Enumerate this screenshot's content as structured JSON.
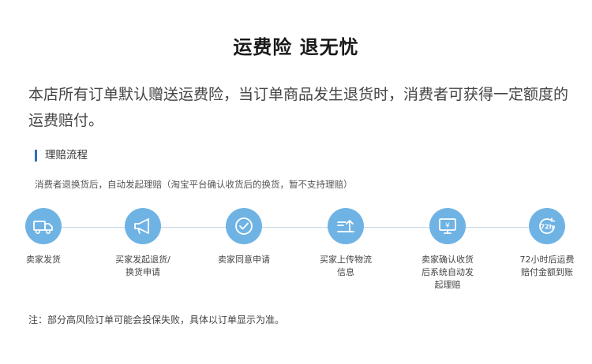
{
  "title": "运费险  退无忧",
  "intro": "本店所有订单默认赠送运费险，当订单商品发生退货时，消费者可获得一定额度的运费赔付。",
  "section": {
    "title": "理赔流程",
    "description": "消费者退换货后，自动发起理赔（淘宝平台确认收货后的换货，暂不支持理赔）"
  },
  "steps": [
    {
      "label": "卖家发货",
      "icon": "truck-icon"
    },
    {
      "label": "买家发起退货/\n换货申请",
      "icon": "megaphone-icon"
    },
    {
      "label": "卖家同意申请",
      "icon": "check-circle-icon"
    },
    {
      "label": "买家上传物流\n信息",
      "icon": "upload-icon"
    },
    {
      "label": "卖家确认收货\n后系统自动发\n起理赔",
      "icon": "monitor-yen-icon"
    },
    {
      "label": "72小时后运费\n赔付金额到账",
      "icon": "clock-72h-icon"
    }
  ],
  "clock_text": "72h",
  "yen_symbol": "¥",
  "note": "注：部分高风险订单可能会投保失败，具体以订单显示为准。",
  "colors": {
    "accent": "#6fb3e4",
    "section_bar": "#2f6fb5",
    "line": "#c8d8e8"
  }
}
